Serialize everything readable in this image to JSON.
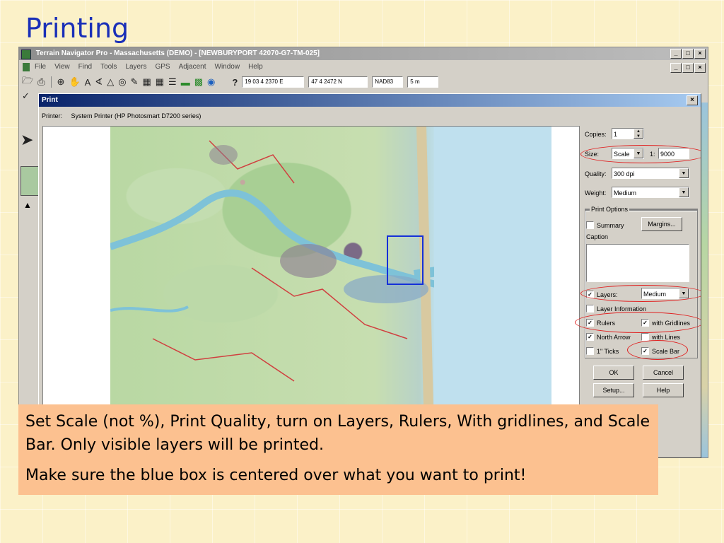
{
  "slide": {
    "title": "Printing"
  },
  "app": {
    "title": "Terrain Navigator Pro - Massachusetts (DEMO) - [NEWBURYPORT 42070-G7-TM-025]",
    "menu": [
      "File",
      "View",
      "Find",
      "Tools",
      "Layers",
      "GPS",
      "Adjacent",
      "Window",
      "Help"
    ],
    "toolbar": {
      "help_glyph": "?",
      "coord_east": "19 03 4 2370 E",
      "coord_north": "47 4 2472 N",
      "datum": "NAD83",
      "elevation": "5 m"
    }
  },
  "dialog": {
    "title": "Print",
    "close_label": "X",
    "printer_label": "Printer:",
    "printer_name": "System Printer (HP Photosmart D7200 series)",
    "copies_label": "Copies:",
    "copies_value": "1",
    "size_label": "Size:",
    "size_mode": "Scale",
    "size_ratio_label": "1:",
    "size_value": "9000",
    "quality_label": "Quality:",
    "quality_value": "300 dpi",
    "weight_label": "Weight:",
    "weight_value": "Medium",
    "print_options_label": "Print Options",
    "summary_label": "Summary",
    "summary_checked": false,
    "margins_button": "Margins...",
    "caption_label": "Caption",
    "layers_label": "Layers:",
    "layers_checked": true,
    "layers_value": "Medium",
    "layer_info_label": "Layer Information",
    "layer_info_checked": false,
    "rulers_label": "Rulers",
    "rulers_checked": true,
    "gridlines_label": "with Gridlines",
    "gridlines_checked": true,
    "north_arrow_label": "North Arrow",
    "north_arrow_checked": true,
    "lines_label": "with Lines",
    "lines_checked": false,
    "ticks_label": "1\" Ticks",
    "ticks_checked": false,
    "scale_bar_label": "Scale Bar",
    "scale_bar_checked": true,
    "ok_button": "OK",
    "cancel_button": "Cancel",
    "setup_button": "Setup...",
    "help_button": "Help"
  },
  "note": {
    "line1": "Set Scale (not %), Print Quality, turn on Layers, Rulers, With gridlines, and  Scale Bar.  Only visible layers will be printed.",
    "line2": "Make sure the blue box is centered over what you want to print!"
  },
  "colors": {
    "title_blue": "#1a2fb8",
    "note_bg": "#fcc190",
    "highlight_red": "#e02020",
    "selection_blue": "#1530d8"
  }
}
